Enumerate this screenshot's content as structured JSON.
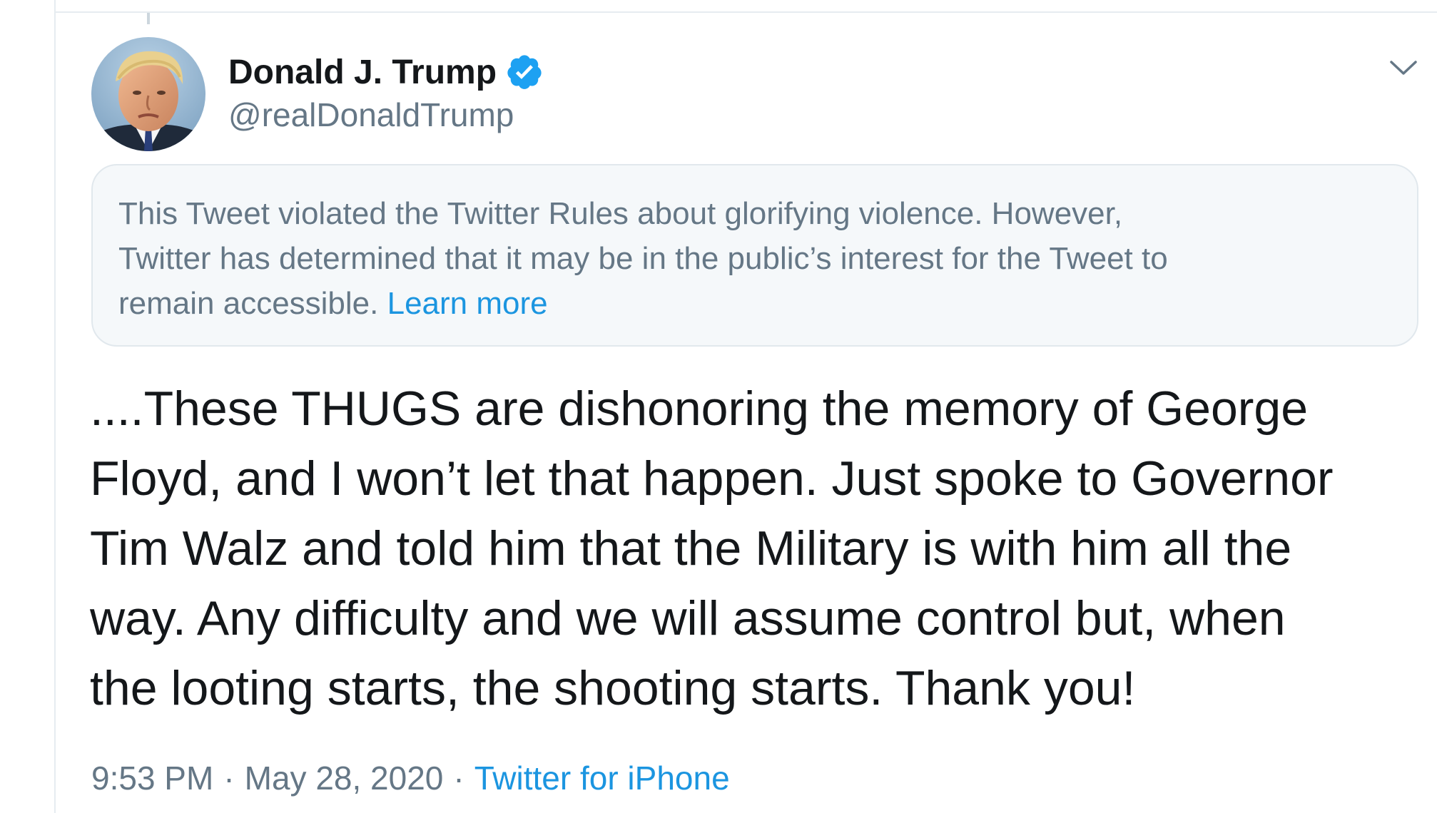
{
  "author": {
    "display_name": "Donald J. Trump",
    "handle": "@realDonaldTrump",
    "avatar_icon": "user-avatar-photo",
    "verified_icon": "verified-badge-icon",
    "verified_color": "#1da1f2"
  },
  "menu": {
    "icon": "chevron-down-icon"
  },
  "notice": {
    "lines": [
      "This Tweet violated the Twitter Rules about glorifying violence. However,",
      "Twitter has determined that it may be in the public’s interest for the Tweet to",
      "remain accessible."
    ],
    "link_label": "Learn more"
  },
  "tweet": {
    "lines": [
      "....These THUGS are dishonoring the memory of George",
      "Floyd, and I won’t let that happen. Just spoke to Governor",
      "Tim Walz and told him that the Military is with him all the",
      "way. Any difficulty and we will assume control but, when",
      "the looting starts, the shooting starts. Thank you!"
    ]
  },
  "meta": {
    "time": "9:53 PM",
    "date": "May 28, 2020",
    "separator": "·",
    "source": "Twitter for iPhone"
  },
  "colors": {
    "text": "#14171a",
    "secondary": "#657786",
    "link": "#1b95e0",
    "notice_bg": "#f5f8fa",
    "border": "#e1e8ed"
  }
}
